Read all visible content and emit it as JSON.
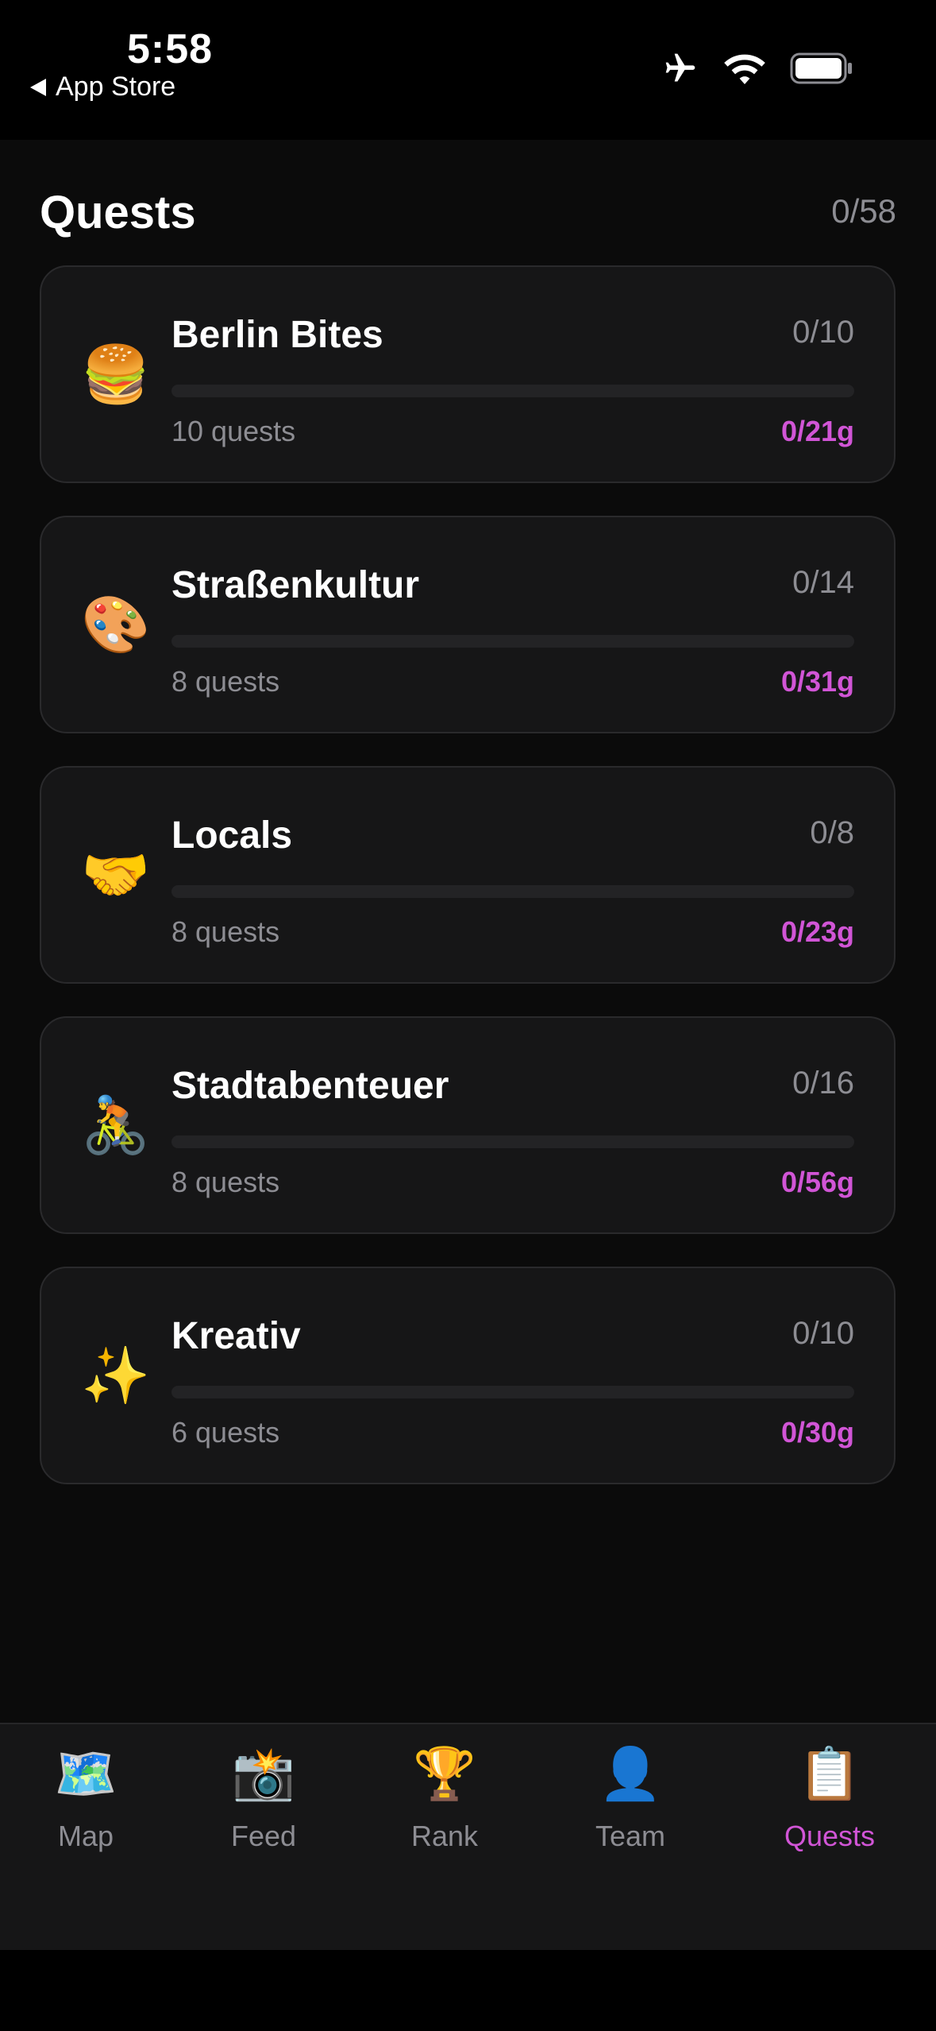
{
  "status_bar": {
    "time": "5:58",
    "back_label": "App Store",
    "icons": [
      "airplane-icon",
      "wifi-icon",
      "battery-icon"
    ]
  },
  "header": {
    "title": "Quests",
    "total_progress": "0/58"
  },
  "categories": [
    {
      "emoji": "🍔",
      "icon": "burger-icon",
      "name": "Berlin Bites",
      "count": "0/10",
      "quests": "10 quests",
      "points": "0/21g",
      "progress": 0
    },
    {
      "emoji": "🎨",
      "icon": "palette-icon",
      "name": "Straßenkultur",
      "count": "0/14",
      "quests": "8 quests",
      "points": "0/31g",
      "progress": 0
    },
    {
      "emoji": "🤝",
      "icon": "handshake-icon",
      "name": "Locals",
      "count": "0/8",
      "quests": "8 quests",
      "points": "0/23g",
      "progress": 0
    },
    {
      "emoji": "🚴",
      "icon": "cyclist-icon",
      "name": "Stadtabenteuer",
      "count": "0/16",
      "quests": "8 quests",
      "points": "0/56g",
      "progress": 0
    },
    {
      "emoji": "✨",
      "icon": "sparkles-icon",
      "name": "Kreativ",
      "count": "0/10",
      "quests": "6 quests",
      "points": "0/30g",
      "progress": 0
    }
  ],
  "tab_bar": {
    "tabs": [
      {
        "emoji": "🗺️",
        "icon": "map-icon",
        "label": "Map",
        "active": false
      },
      {
        "emoji": "📸",
        "icon": "camera-icon",
        "label": "Feed",
        "active": false
      },
      {
        "emoji": "🏆",
        "icon": "trophy-icon",
        "label": "Rank",
        "active": false
      },
      {
        "emoji": "👤",
        "icon": "person-icon",
        "label": "Team",
        "active": false
      },
      {
        "emoji": "📋",
        "icon": "clipboard-icon",
        "label": "Quests",
        "active": true
      }
    ]
  },
  "colors": {
    "accent": "#d155d6",
    "background": "#0b0b0b",
    "card": "#161617",
    "muted_text": "#8d8d93"
  }
}
